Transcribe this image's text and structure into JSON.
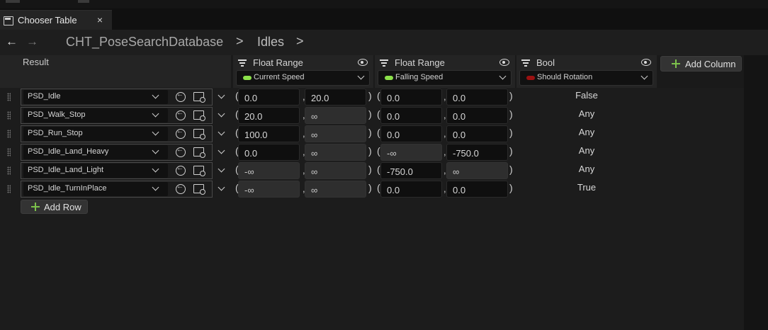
{
  "tab": {
    "label": "Chooser Table",
    "close_glyph": "×"
  },
  "breadcrumb": {
    "back_glyph": "←",
    "forward_glyph": "→",
    "items": [
      "CHT_PoseSearchDatabase",
      "Idles"
    ],
    "separator": ">"
  },
  "header": {
    "result_label": "Result",
    "columns": [
      {
        "title": "Float Range",
        "selection": "Current Speed",
        "pill_color": "#8be04a"
      },
      {
        "title": "Float Range",
        "selection": "Falling Speed",
        "pill_color": "#8be04a"
      },
      {
        "title": "Bool",
        "selection": "Should Rotation",
        "pill_color": "#9b1111"
      }
    ],
    "add_column_label": "Add Column"
  },
  "rows": [
    {
      "result": "PSD_Idle",
      "r1": [
        "0.0",
        "20.0"
      ],
      "r2": [
        "0.0",
        "0.0"
      ],
      "bool": "False"
    },
    {
      "result": "PSD_Walk_Stop",
      "r1": [
        "20.0",
        "∞"
      ],
      "r2": [
        "0.0",
        "0.0"
      ],
      "bool": "Any"
    },
    {
      "result": "PSD_Run_Stop",
      "r1": [
        "100.0",
        "∞"
      ],
      "r2": [
        "0.0",
        "0.0"
      ],
      "bool": "Any"
    },
    {
      "result": "PSD_Idle_Land_Heavy",
      "r1": [
        "0.0",
        "∞"
      ],
      "r2": [
        "-∞",
        "-750.0"
      ],
      "bool": "Any"
    },
    {
      "result": "PSD_Idle_Land_Light",
      "r1": [
        "-∞",
        "∞"
      ],
      "r2": [
        "-750.0",
        "∞"
      ],
      "bool": "Any"
    },
    {
      "result": "PSD_Idle_TurnInPlace",
      "r1": [
        "-∞",
        "∞"
      ],
      "r2": [
        "0.0",
        "0.0"
      ],
      "bool": "True"
    }
  ],
  "add_row_label": "Add Row",
  "colors": {
    "accent_green": "#7cc14b",
    "background": "#1c1c1c",
    "infinity_cell": "#2e2e2e"
  }
}
